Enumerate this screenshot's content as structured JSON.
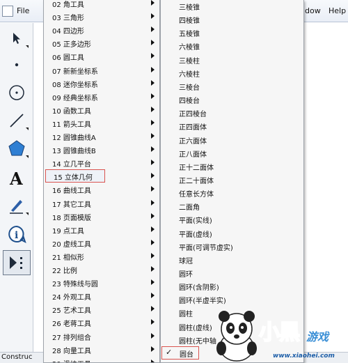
{
  "menubar": {
    "file": "File",
    "window": "dow",
    "help": "Help"
  },
  "toolbar": {
    "tools": [
      {
        "icon": "pointer-arrow-icon"
      },
      {
        "icon": "point-icon"
      },
      {
        "icon": "compass-circle-icon"
      },
      {
        "icon": "line-segment-icon"
      },
      {
        "icon": "polygon-icon"
      },
      {
        "icon": "text-tool-icon"
      },
      {
        "icon": "marker-pen-icon"
      },
      {
        "icon": "info-icon"
      },
      {
        "icon": "custom-tools-icon"
      }
    ]
  },
  "status": {
    "text": "Construc"
  },
  "menu1": {
    "items": [
      "02 角工具",
      "03 三角形",
      "04 四边形",
      "05 正多边形",
      "06 圆工具",
      "07 新新坐标系",
      "08 迷你坐标系",
      "09 经典坐标系",
      "10 函数工具",
      "11 箭头工具",
      "12 圆锥曲线A",
      "13 圆锥曲线B",
      "14 立几平台",
      "15 立体几何",
      "16 曲线工具",
      "17 其它工具",
      "18 页面模版",
      "19 点工具",
      "20 虚线工具",
      "21 相似形",
      "22 比例",
      "23 特殊线与圆",
      "24 外观工具",
      "25 艺术工具",
      "26 老蒋工具",
      "27 排列组合",
      "28 向量工具",
      "29 滑块工具"
    ],
    "selected": "15 立体几何"
  },
  "menu2": {
    "items": [
      "三棱锥",
      "四棱锥",
      "五棱锥",
      "六棱锥",
      "三棱柱",
      "六棱柱",
      "三棱台",
      "四棱台",
      "正四棱台",
      "正四面体",
      "正六面体",
      "正八面体",
      "正十二面体",
      "正二十面体",
      "任意长方体",
      "二面角",
      "平面(实线)",
      "平面(虚线)",
      "平面(可调节虚实)",
      "球冠",
      "圆环",
      "圆环(含阴影)",
      "圆环(半虚半实)",
      "圆柱",
      "圆柱(虚线)",
      "圆柱(无中轴",
      "圆台"
    ],
    "checked": "圆台",
    "check_mark": "✓"
  },
  "watermark": {
    "brand": "小黑",
    "brand_suffix": "游戏",
    "url": "www.xiaohei.com"
  },
  "colors": {
    "highlight_outline": "#d9534f",
    "brand_blue": "#3a8fd6"
  }
}
